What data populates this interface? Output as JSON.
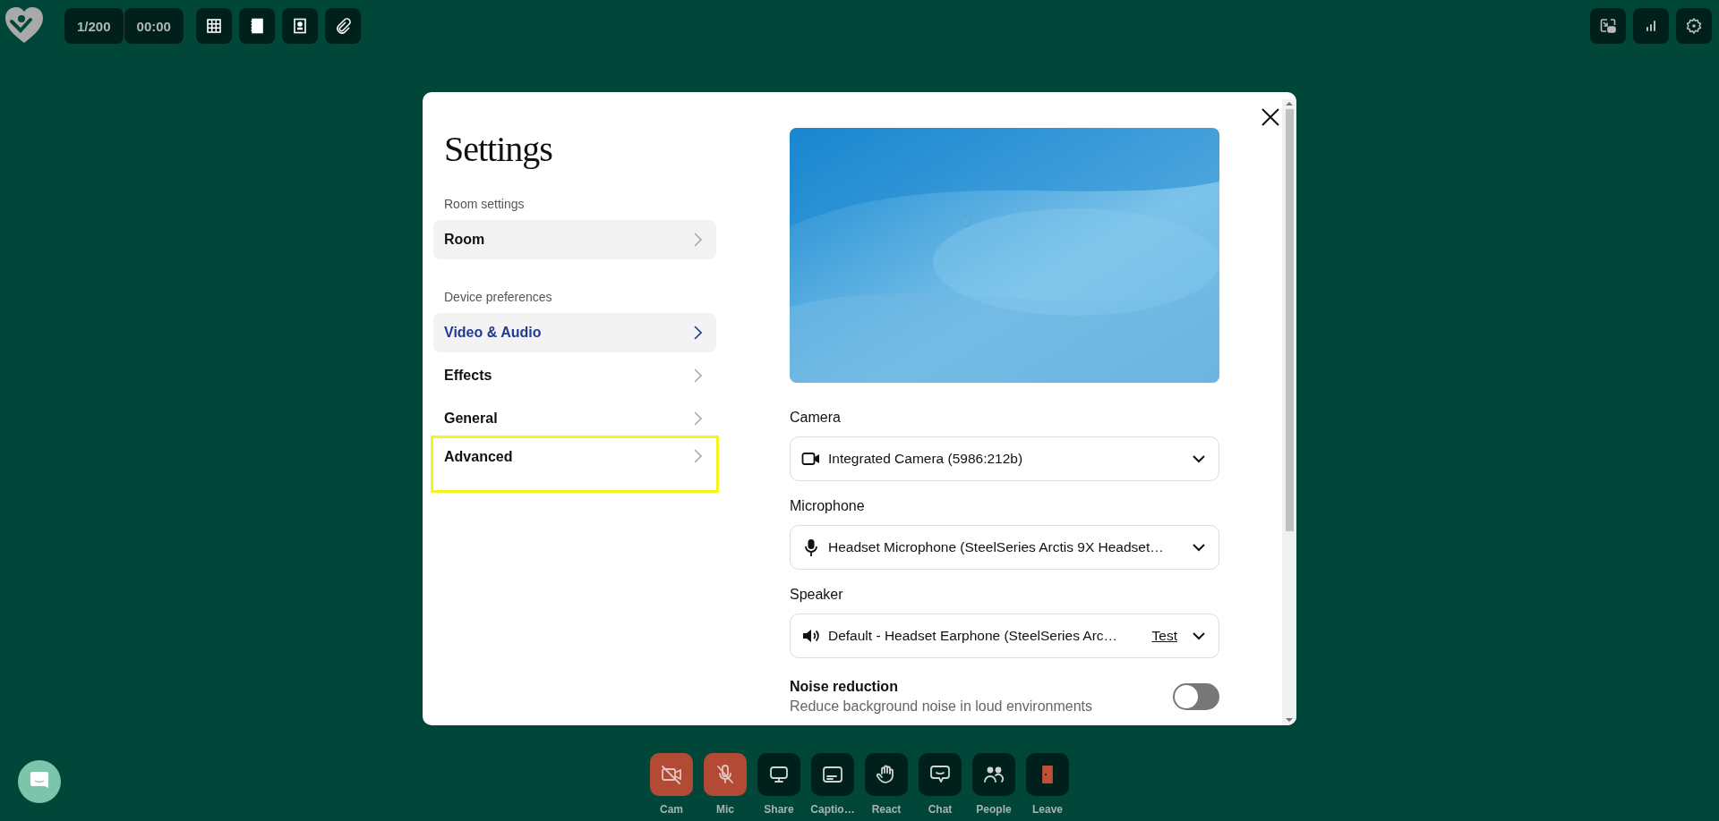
{
  "top_bar": {
    "participants": "1/200",
    "timer": "00:00",
    "tools": [
      {
        "kind": "grid"
      },
      {
        "kind": "notebook"
      },
      {
        "kind": "contact"
      },
      {
        "kind": "attach"
      }
    ],
    "right_tools": [
      {
        "kind": "pip"
      },
      {
        "kind": "stats"
      },
      {
        "kind": "settings"
      }
    ]
  },
  "dialog": {
    "title": "Settings",
    "sections": [
      {
        "heading": "Room settings",
        "items": [
          {
            "label": "Room",
            "highlighted": true,
            "selected": false,
            "focused": false
          }
        ]
      },
      {
        "heading": "Device preferences",
        "items": [
          {
            "label": "Video & Audio",
            "highlighted": true,
            "selected": true,
            "focused": false
          },
          {
            "label": "Effects",
            "highlighted": false,
            "selected": false,
            "focused": false
          },
          {
            "label": "General",
            "highlighted": false,
            "selected": false,
            "focused": false
          },
          {
            "label": "Advanced",
            "highlighted": false,
            "selected": false,
            "focused": true
          }
        ]
      }
    ],
    "devices": [
      {
        "kind": "camera",
        "label": "Camera",
        "value": "Integrated Camera (5986:212b)"
      },
      {
        "kind": "microphone",
        "label": "Microphone",
        "value": "Headset Microphone (SteelSeries Arctis 9X Headset…"
      },
      {
        "kind": "speaker",
        "label": "Speaker",
        "value": "Default - Headset Earphone (SteelSeries Arc…",
        "link": "Test"
      }
    ],
    "noise_reduction": {
      "title": "Noise reduction",
      "description": "Reduce background noise in loud environments",
      "on": false
    }
  },
  "controls": [
    {
      "kind": "cam",
      "label": "Cam",
      "muted": true
    },
    {
      "kind": "mic",
      "label": "Mic",
      "muted": true
    },
    {
      "kind": "share",
      "label": "Share",
      "muted": false
    },
    {
      "kind": "captions",
      "label": "Captio…",
      "muted": false
    },
    {
      "kind": "react",
      "label": "React",
      "muted": false
    },
    {
      "kind": "chat",
      "label": "Chat",
      "muted": false
    },
    {
      "kind": "people",
      "label": "People",
      "muted": false
    },
    {
      "kind": "leave",
      "label": "Leave",
      "muted": false
    }
  ]
}
